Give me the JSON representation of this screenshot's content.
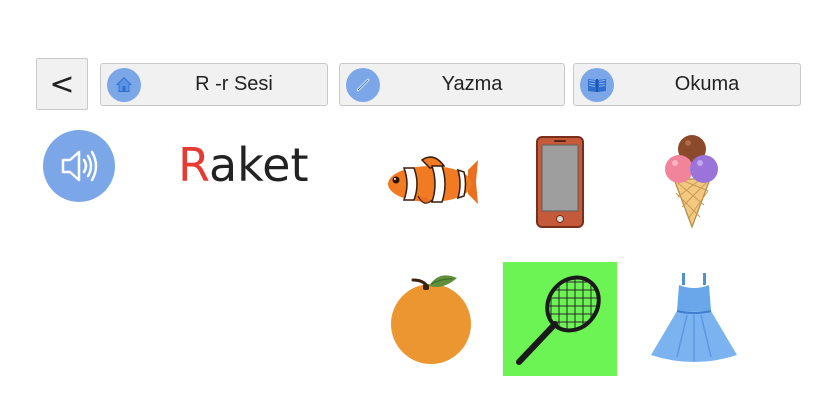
{
  "toolbar": {
    "back_label": "<",
    "home_label": "R -r Sesi",
    "write_label": "Yazma",
    "read_label": "Okuma"
  },
  "lesson": {
    "word_first_letter": "R",
    "word_rest": "aket"
  },
  "colors": {
    "icon_circle": "#7ba7e8",
    "highlight_letter": "#e53b32",
    "selected_tile": "#6cf354"
  },
  "pictures": [
    {
      "name": "clownfish",
      "icon": "fish-icon",
      "selected": false
    },
    {
      "name": "phone",
      "icon": "phone-icon",
      "selected": false
    },
    {
      "name": "ice-cream",
      "icon": "ice-cream-icon",
      "selected": false
    },
    {
      "name": "orange",
      "icon": "orange-icon",
      "selected": false
    },
    {
      "name": "racket",
      "icon": "racket-icon",
      "selected": true
    },
    {
      "name": "dress",
      "icon": "dress-icon",
      "selected": false
    }
  ]
}
